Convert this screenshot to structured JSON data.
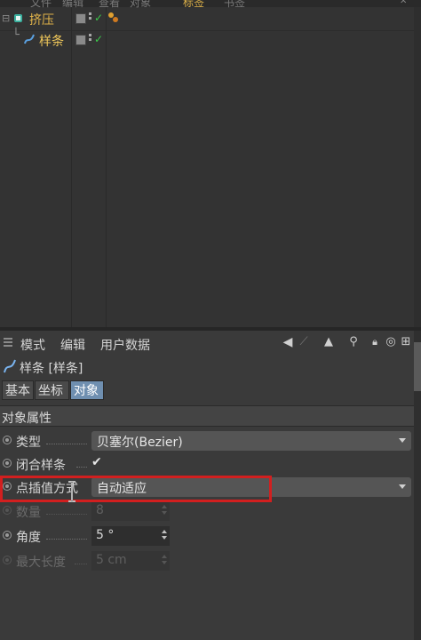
{
  "object_manager": {
    "top_menu": [
      "文件",
      "编辑",
      "查看",
      "对象",
      "标签",
      "书签"
    ],
    "objects": [
      {
        "name": "挤压",
        "color": "#e0b34a",
        "tree": "白"
      },
      {
        "name": "样条",
        "color": "#f0c85a",
        "tree": "└"
      }
    ]
  },
  "attr": {
    "menu": [
      "模式",
      "编辑",
      "用户数据"
    ],
    "title": "样条 [样条]",
    "tabs": [
      "基本",
      "坐标",
      "对象"
    ],
    "active_tab": "对象",
    "section": "对象属性",
    "props": {
      "type_label": "类型",
      "type_value": "贝塞尔(Bezier)",
      "closed_label": "闭合样条",
      "closed_value": "✔",
      "interp_label": "点插值方式",
      "interp_value": "自动适应",
      "count_label": "数量",
      "count_value": "8",
      "angle_label": "角度",
      "angle_value": "5 °",
      "maxlen_label": "最大长度",
      "maxlen_value": "5 cm"
    }
  },
  "colors": {
    "highlight": "#d21f1f",
    "active_tab": "#6f8fb0",
    "check_green": "#3cc94b"
  }
}
